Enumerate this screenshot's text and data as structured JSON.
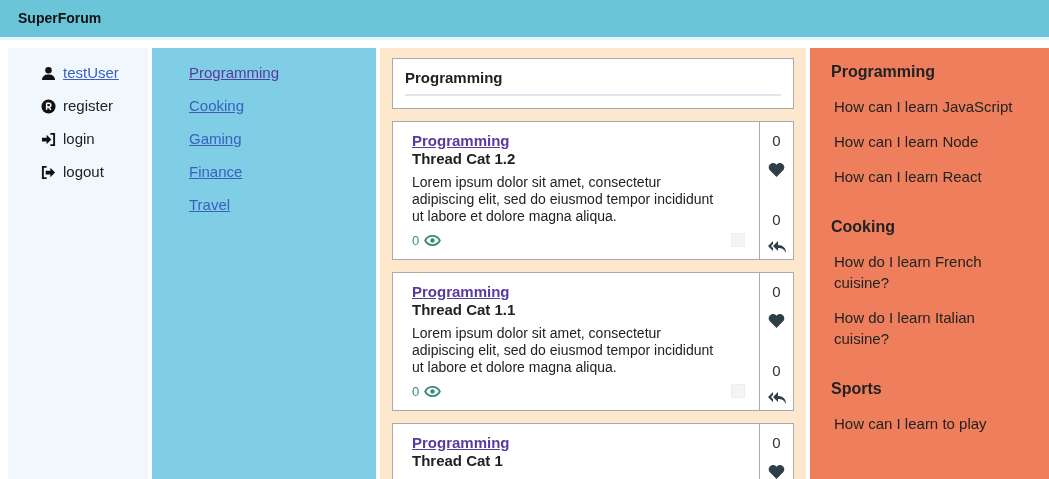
{
  "header": {
    "title": "SuperForum"
  },
  "user_menu": [
    {
      "kind": "user",
      "label": "testUser"
    },
    {
      "kind": "register",
      "label": "register"
    },
    {
      "kind": "login",
      "label": "login"
    },
    {
      "kind": "logout",
      "label": "logout"
    }
  ],
  "categories": [
    {
      "label": "Programming",
      "visited": true
    },
    {
      "label": "Cooking",
      "visited": false
    },
    {
      "label": "Gaming",
      "visited": false
    },
    {
      "label": "Finance",
      "visited": false
    },
    {
      "label": "Travel",
      "visited": false
    }
  ],
  "category_header": {
    "title": "Programming"
  },
  "threads": [
    {
      "category": "Programming",
      "title": "Thread Cat 1.2",
      "body": "Lorem ipsum dolor sit amet, consectetur adipiscing elit, sed do eiusmod tempor incididunt ut labore et dolore magna aliqua.",
      "views": "0",
      "likes": "0",
      "replies": "0"
    },
    {
      "category": "Programming",
      "title": "Thread Cat 1.1",
      "body": "Lorem ipsum dolor sit amet, consectetur adipiscing elit, sed do eiusmod tempor incididunt ut labore et dolore magna aliqua.",
      "views": "0",
      "likes": "0",
      "replies": "0"
    },
    {
      "category": "Programming",
      "title": "Thread Cat 1",
      "likes": "0"
    }
  ],
  "top_threads": [
    {
      "category": "Programming",
      "items": [
        "How can I learn JavaScript",
        "How can I learn Node",
        "How can I learn React"
      ]
    },
    {
      "category": "Cooking",
      "items": [
        "How do I learn French cuisine?",
        "How do I learn Italian cuisine?"
      ]
    },
    {
      "category": "Sports",
      "items": [
        "How can I learn to play"
      ]
    }
  ]
}
